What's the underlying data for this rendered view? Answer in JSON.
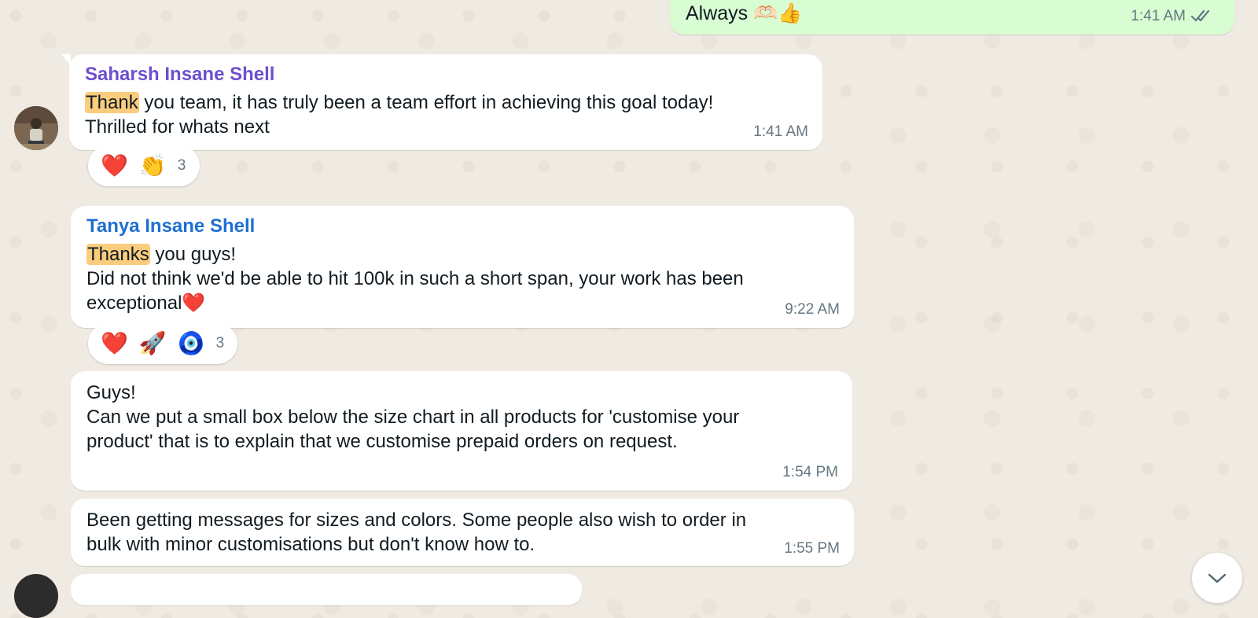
{
  "messages": [
    {
      "direction": "outgoing",
      "text": "Always 🫶🏻👍",
      "time": "1:41 AM",
      "status_icon": "double-check-icon"
    },
    {
      "direction": "incoming",
      "sender": "Saharsh Insane Shell",
      "sender_color": "#6e4fd0",
      "highlight": "Thank",
      "lines": [
        "you team, it has truly been a team effort in achieving this goal today!",
        "Thrilled for whats next"
      ],
      "time": "1:41 AM",
      "reactions": [
        "❤️",
        "👏"
      ],
      "reaction_count": "3"
    },
    {
      "direction": "incoming",
      "sender": "Tanya Insane Shell",
      "sender_color": "#1f6fd1",
      "highlight": "Thanks",
      "lines": [
        "you guys!",
        "Did not think we'd be able to hit 100k in such a short span, your work has been",
        "exceptional❤️"
      ],
      "time": "9:22 AM",
      "reactions": [
        "❤️",
        "🚀",
        "🧿"
      ],
      "reaction_count": "3"
    },
    {
      "direction": "incoming",
      "lines": [
        "Guys!",
        "Can we put a small box below the size chart in all products for 'customise your",
        "product' that is to explain that we customise prepaid orders on request."
      ],
      "time": "1:54 PM"
    },
    {
      "direction": "incoming",
      "lines": [
        "Been getting messages for sizes and colors. Some people also wish to order in",
        "bulk with minor customisations but don't know how to."
      ],
      "time": "1:55 PM"
    }
  ],
  "scroll_button": {
    "icon": "chevron-down-icon"
  },
  "colors": {
    "chat_background": "#efeae2",
    "incoming_bubble": "#ffffff",
    "outgoing_bubble": "#d9fdd3",
    "search_highlight": "#f9cd7d",
    "timestamp": "#667781"
  }
}
